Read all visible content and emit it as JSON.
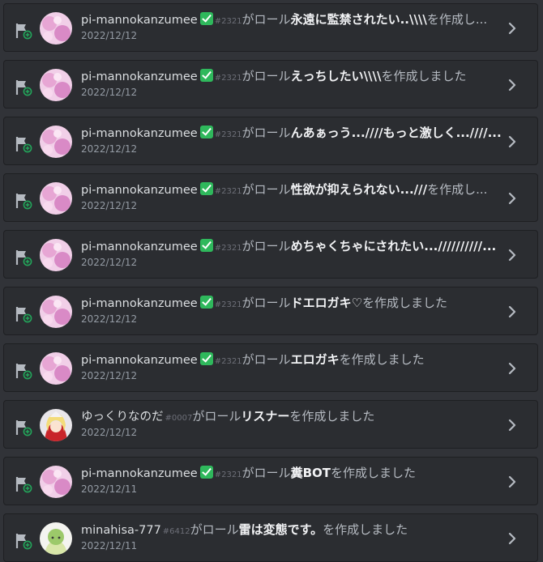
{
  "entries": [
    {
      "username": "pi-mannokanzumee",
      "verified": true,
      "discriminator": "#2321",
      "prefix": "がロール",
      "role": "永遠に監禁されたい..\\\\\\\\",
      "suffix": "を作成し...",
      "date": "2022/12/12",
      "avatar": "pink"
    },
    {
      "username": "pi-mannokanzumee",
      "verified": true,
      "discriminator": "#2321",
      "prefix": "がロール",
      "role": "えっちしたい\\\\\\\\",
      "suffix": "を作成しました",
      "date": "2022/12/12",
      "avatar": "pink"
    },
    {
      "username": "pi-mannokanzumee",
      "verified": true,
      "discriminator": "#2321",
      "prefix": "がロール",
      "role": "んあぁっう...////もっと激しく...////...",
      "suffix": "",
      "date": "2022/12/12",
      "avatar": "pink"
    },
    {
      "username": "pi-mannokanzumee",
      "verified": true,
      "discriminator": "#2321",
      "prefix": "がロール",
      "role": "性欲が抑えられない...///",
      "suffix": "を作成し...",
      "date": "2022/12/12",
      "avatar": "pink"
    },
    {
      "username": "pi-mannokanzumee",
      "verified": true,
      "discriminator": "#2321",
      "prefix": "がロール",
      "role": "めちゃくちゃにされたい...//////////...",
      "suffix": "",
      "date": "2022/12/12",
      "avatar": "pink"
    },
    {
      "username": "pi-mannokanzumee",
      "verified": true,
      "discriminator": "#2321",
      "prefix": "がロール",
      "role": "ドエロガキ♡",
      "suffix": "を作成しました",
      "date": "2022/12/12",
      "avatar": "pink"
    },
    {
      "username": "pi-mannokanzumee",
      "verified": true,
      "discriminator": "#2321",
      "prefix": "がロール",
      "role": "エロガキ",
      "suffix": "を作成しました",
      "date": "2022/12/12",
      "avatar": "pink"
    },
    {
      "username": "ゆっくりなのだ",
      "verified": false,
      "discriminator": "#0007",
      "prefix": "がロール",
      "role": "リスナー",
      "suffix": "を作成しました",
      "date": "2022/12/12",
      "avatar": "anime"
    },
    {
      "username": "pi-mannokanzumee",
      "verified": true,
      "discriminator": "#2321",
      "prefix": "がロール",
      "role": "糞BOT",
      "suffix": "を作成しました",
      "date": "2022/12/11",
      "avatar": "pink"
    },
    {
      "username": "minahisa-777",
      "verified": false,
      "discriminator": "#6412",
      "prefix": "がロール",
      "role": "雷は変態です。",
      "suffix": "を作成しました",
      "date": "2022/12/11",
      "avatar": "green"
    }
  ],
  "icons": {
    "left": "flag-plus-icon",
    "right": "chevron-right-icon"
  },
  "colors": {
    "background": "#313338",
    "card": "#2b2d31",
    "verified": "#2fb85c"
  }
}
